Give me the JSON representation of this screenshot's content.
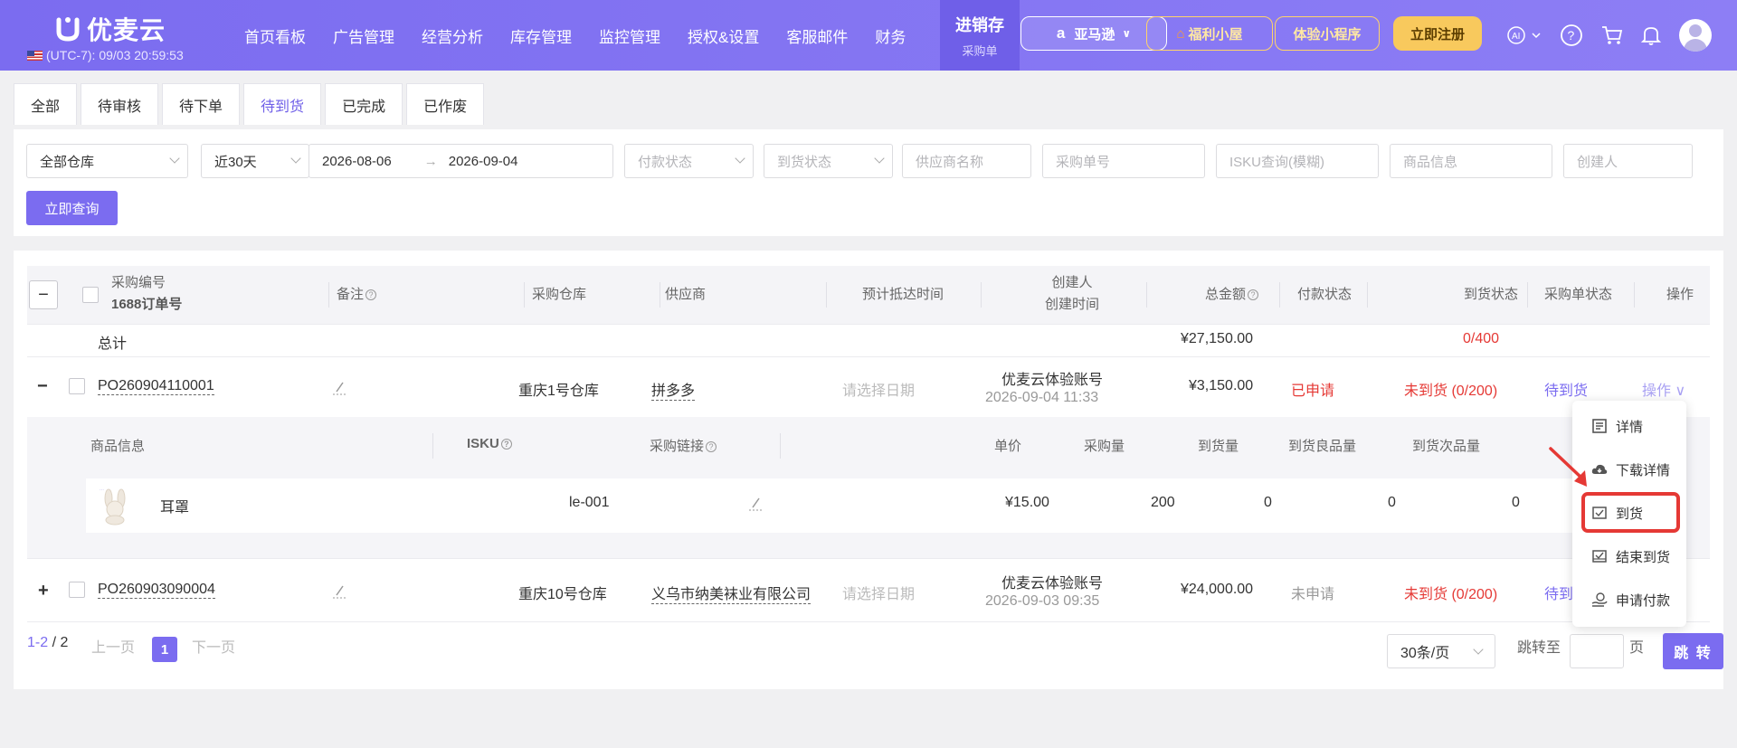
{
  "header": {
    "brand": "优麦云",
    "timezone": "(UTC-7): 09/03 20:59:53",
    "nav": [
      "首页看板",
      "广告管理",
      "经营分析",
      "库存管理",
      "监控管理",
      "授权&设置",
      "客服邮件",
      "财务"
    ],
    "active_nav": {
      "label": "进销存",
      "sub": "采购单"
    },
    "marketplace": "亚马逊",
    "welfare": "福利小屋",
    "mini_program": "体验小程序",
    "register": "立即注册",
    "accent": "#7b6cf0"
  },
  "tabs": [
    "全部",
    "待审核",
    "待下单",
    "待到货",
    "已完成",
    "已作废"
  ],
  "active_tab": "待到货",
  "filters": {
    "warehouse": "全部仓库",
    "range": "近30天",
    "date_start": "2026-08-06",
    "date_end": "2026-09-04",
    "payment_status_ph": "付款状态",
    "arrival_status_ph": "到货状态",
    "supplier_ph": "供应商名称",
    "po_no_ph": "采购单号",
    "isku_ph": "ISKU查询(模糊)",
    "product_ph": "商品信息",
    "creator_ph": "创建人",
    "query_btn": "立即查询"
  },
  "table": {
    "headers": {
      "po_no": "采购编号",
      "order_1688": "1688订单号",
      "remark": "备注",
      "warehouse": "采购仓库",
      "supplier": "供应商",
      "eta": "预计抵达时间",
      "creator": "创建人",
      "created_time": "创建时间",
      "total": "总金额",
      "payment_status": "付款状态",
      "arrival_status": "到货状态",
      "po_status": "采购单状态",
      "action": "操作"
    },
    "total_row": {
      "label": "总计",
      "amount": "¥27,150.00",
      "arrival": "0/400"
    },
    "rows": [
      {
        "po_no": "PO260904110001",
        "warehouse": "重庆1号仓库",
        "supplier": "拼多多",
        "eta": "请选择日期",
        "creator": "优麦云体验账号",
        "created": "2026-09-04 11:33",
        "total": "¥3,150.00",
        "payment": "已申请",
        "arrival": "未到货 (0/200)",
        "status": "待到货",
        "action": "操作"
      },
      {
        "po_no": "PO260903090004",
        "warehouse": "重庆10号仓库",
        "supplier": "义乌市纳美袜业有限公司",
        "eta": "请选择日期",
        "creator": "优麦云体验账号",
        "created": "2026-09-03 09:35",
        "total": "¥24,000.00",
        "payment": "未申请",
        "arrival": "未到货 (0/200)",
        "status": "待到"
      }
    ],
    "sub_headers": {
      "product": "商品信息",
      "isku": "ISKU",
      "link": "采购链接",
      "unit_price": "单价",
      "qty": "采购量",
      "arrived": "到货量",
      "good": "到货良品量",
      "defect": "到货次品量"
    },
    "sub_row": {
      "name": "耳罩",
      "isku": "le-001",
      "unit_price": "¥15.00",
      "qty": "200",
      "arrived": "0",
      "good": "0",
      "defect": "0"
    }
  },
  "pagination": {
    "range": "1-2",
    "sep": "/",
    "total": "2",
    "prev": "上一页",
    "page": "1",
    "next": "下一页",
    "page_size": "30条/页",
    "jump_label": "跳转至",
    "page_unit": "页",
    "jump_btn": "跳 转"
  },
  "action_menu": [
    "详情",
    "下载详情",
    "到货",
    "结束到货",
    "申请付款"
  ],
  "highlight_color": "#e53935"
}
